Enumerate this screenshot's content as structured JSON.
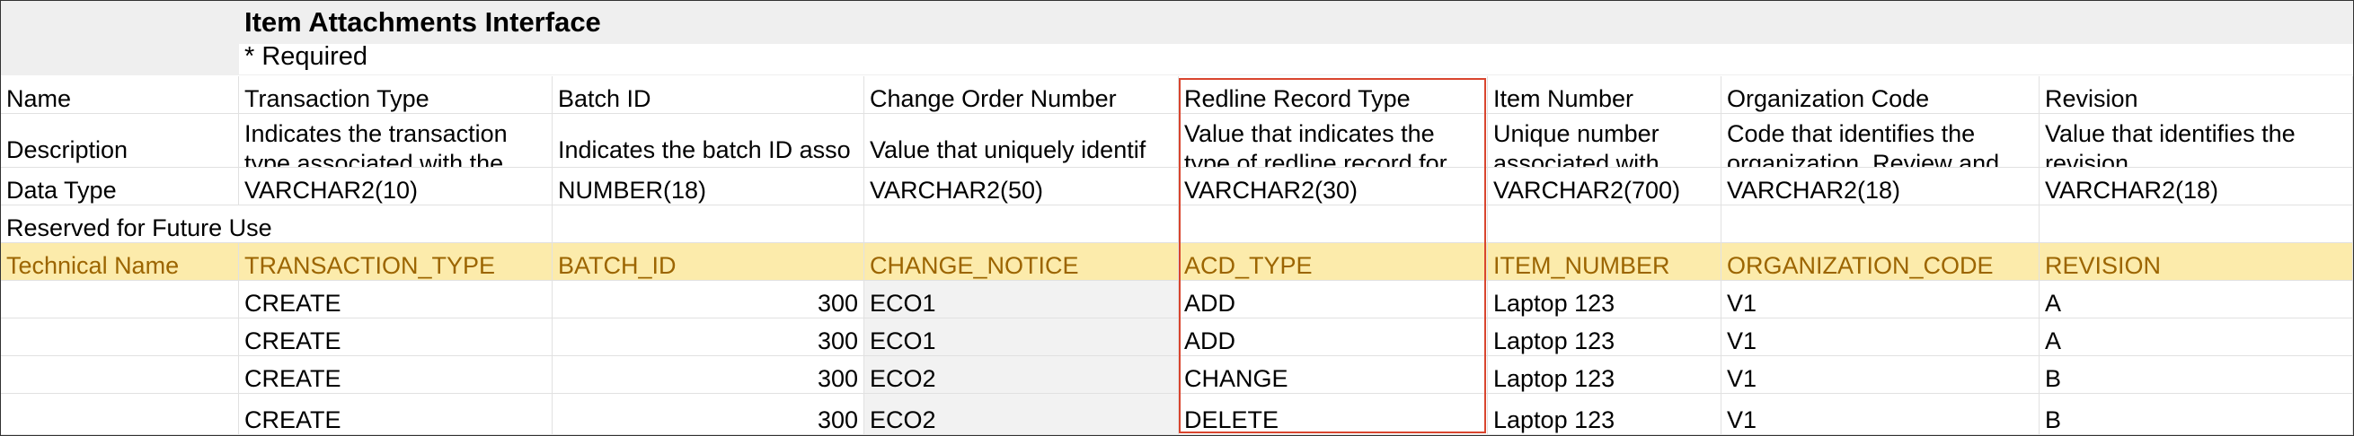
{
  "sheet": {
    "title": "Item Attachments Interface",
    "required_note": "* Required"
  },
  "row_labels": {
    "name": "Name",
    "description": "Description",
    "data_type": "Data Type",
    "reserved": "Reserved for Future Use",
    "technical_name": "Technical Name"
  },
  "columns": [
    {
      "name": "Transaction Type",
      "description": "Indicates the transaction type associated with the",
      "data_type": "VARCHAR2(10)",
      "technical_name": "TRANSACTION_TYPE"
    },
    {
      "name": "Batch ID",
      "description": "Indicates the batch ID asso",
      "data_type": "NUMBER(18)",
      "technical_name": "BATCH_ID"
    },
    {
      "name": "Change Order Number",
      "description": "Value that uniquely identif",
      "data_type": "VARCHAR2(50)",
      "technical_name": "CHANGE_NOTICE"
    },
    {
      "name": "Redline Record Type",
      "description": "Value that indicates the type of redline record for",
      "data_type": "VARCHAR2(30)",
      "technical_name": "ACD_TYPE"
    },
    {
      "name": "Item Number",
      "description": "Unique number associated with",
      "data_type": "VARCHAR2(700)",
      "technical_name": "ITEM_NUMBER"
    },
    {
      "name": "Organization Code",
      "description": "Code that identifies the organization. Review and",
      "data_type": "VARCHAR2(18)",
      "technical_name": "ORGANIZATION_CODE"
    },
    {
      "name": "Revision",
      "description": "Value that identifies the revision",
      "data_type": "VARCHAR2(18)",
      "technical_name": "REVISION"
    }
  ],
  "rows": [
    [
      "CREATE",
      "300",
      "ECO1",
      "ADD",
      "Laptop 123",
      "V1",
      "A"
    ],
    [
      "CREATE",
      "300",
      "ECO1",
      "ADD",
      "Laptop 123",
      "V1",
      "A"
    ],
    [
      "CREATE",
      "300",
      "ECO2",
      "CHANGE",
      "Laptop 123",
      "V1",
      "B"
    ],
    [
      "CREATE",
      "300",
      "ECO2",
      "DELETE",
      "Laptop 123",
      "V1",
      "B"
    ]
  ],
  "colors": {
    "technical_row_bg": "#fcebab",
    "technical_row_text": "#9c6500",
    "highlight_border": "#d9452e"
  }
}
